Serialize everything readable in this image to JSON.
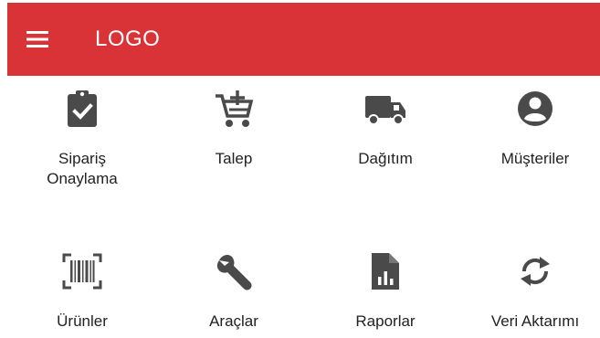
{
  "appbar": {
    "menu_icon": "menu-icon",
    "brand": "LOGO",
    "background": "#da3337"
  },
  "tiles": [
    {
      "label": "Sipariş Onaylama",
      "icon": "clipboard-check-icon"
    },
    {
      "label": "Talep",
      "icon": "cart-plus-icon"
    },
    {
      "label": "Dağıtım",
      "icon": "truck-icon"
    },
    {
      "label": "Müşteriler",
      "icon": "account-circle-icon"
    },
    {
      "label": "Ürünler",
      "icon": "barcode-scan-icon"
    },
    {
      "label": "Araçlar",
      "icon": "wrench-icon"
    },
    {
      "label": "Raporlar",
      "icon": "report-file-icon"
    },
    {
      "label": "Veri Aktarımı",
      "icon": "sync-icon"
    }
  ],
  "colors": {
    "icon": "#4a4a4a",
    "text": "#222222"
  }
}
